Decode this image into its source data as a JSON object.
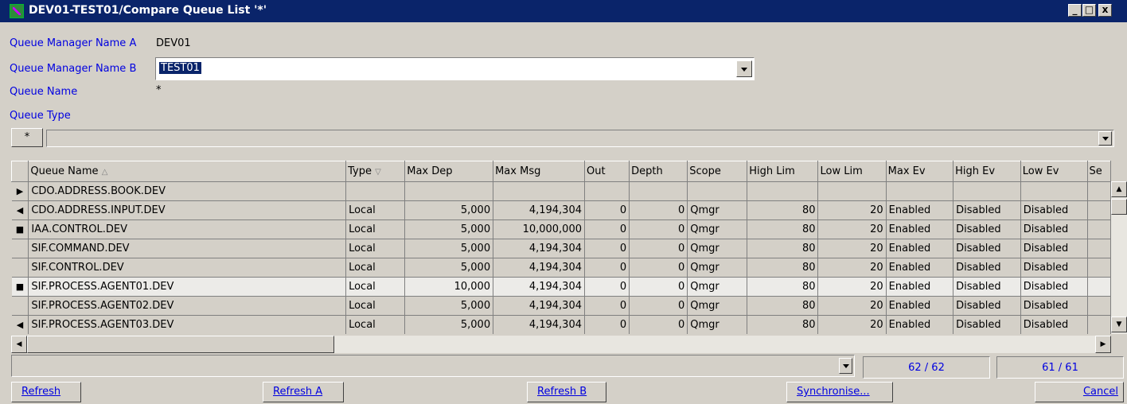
{
  "window": {
    "title": "DEV01-TEST01/Compare Queue List '*'",
    "min": "_",
    "max": "□",
    "close": "x"
  },
  "form": {
    "qm_a_label": "Queue Manager Name A",
    "qm_a_value": "DEV01",
    "qm_b_label": "Queue Manager Name B",
    "qm_b_value": "TEST01",
    "queue_name_label": "Queue Name",
    "queue_name_value": "*",
    "queue_type_label": "Queue Type"
  },
  "filter": {
    "star": "*"
  },
  "columns": [
    "Queue Name",
    "Type",
    "Max Dep",
    "Max Msg",
    "Out",
    "Depth",
    "Scope",
    "High Lim",
    "Low Lim",
    "Max Ev",
    "High Ev",
    "Low Ev",
    "Se"
  ],
  "rows": [
    {
      "ind": "▶",
      "name": "CDO.ADDRESS.BOOK.DEV",
      "type": "",
      "maxdep": "",
      "maxmsg": "",
      "out": "",
      "depth": "",
      "scope": "",
      "high": "",
      "low": "",
      "maxev": "",
      "highev": "",
      "lowev": ""
    },
    {
      "ind": "◀",
      "name": "CDO.ADDRESS.INPUT.DEV",
      "type": "Local",
      "maxdep": "5,000",
      "maxmsg": "4,194,304",
      "out": "0",
      "depth": "0",
      "scope": "Qmgr",
      "high": "80",
      "low": "20",
      "maxev": "Enabled",
      "highev": "Disabled",
      "lowev": "Disabled"
    },
    {
      "ind": "■",
      "name": "IAA.CONTROL.DEV",
      "type": "Local",
      "maxdep": "5,000",
      "maxmsg": "10,000,000",
      "out": "0",
      "depth": "0",
      "scope": "Qmgr",
      "high": "80",
      "low": "20",
      "maxev": "Enabled",
      "highev": "Disabled",
      "lowev": "Disabled"
    },
    {
      "ind": "",
      "name": "SIF.COMMAND.DEV",
      "type": "Local",
      "maxdep": "5,000",
      "maxmsg": "4,194,304",
      "out": "0",
      "depth": "0",
      "scope": "Qmgr",
      "high": "80",
      "low": "20",
      "maxev": "Enabled",
      "highev": "Disabled",
      "lowev": "Disabled"
    },
    {
      "ind": "",
      "name": "SIF.CONTROL.DEV",
      "type": "Local",
      "maxdep": "5,000",
      "maxmsg": "4,194,304",
      "out": "0",
      "depth": "0",
      "scope": "Qmgr",
      "high": "80",
      "low": "20",
      "maxev": "Enabled",
      "highev": "Disabled",
      "lowev": "Disabled"
    },
    {
      "ind": "■",
      "name": "SIF.PROCESS.AGENT01.DEV",
      "type": "Local",
      "maxdep": "10,000",
      "maxmsg": "4,194,304",
      "out": "0",
      "depth": "0",
      "scope": "Qmgr",
      "high": "80",
      "low": "20",
      "maxev": "Enabled",
      "highev": "Disabled",
      "lowev": "Disabled"
    },
    {
      "ind": "",
      "name": "SIF.PROCESS.AGENT02.DEV",
      "type": "Local",
      "maxdep": "5,000",
      "maxmsg": "4,194,304",
      "out": "0",
      "depth": "0",
      "scope": "Qmgr",
      "high": "80",
      "low": "20",
      "maxev": "Enabled",
      "highev": "Disabled",
      "lowev": "Disabled"
    },
    {
      "ind": "◀",
      "name": "SIF.PROCESS.AGENT03.DEV",
      "type": "Local",
      "maxdep": "5,000",
      "maxmsg": "4,194,304",
      "out": "0",
      "depth": "0",
      "scope": "Qmgr",
      "high": "80",
      "low": "20",
      "maxev": "Enabled",
      "highev": "Disabled",
      "lowev": "Disabled"
    }
  ],
  "counts": {
    "a": "62 / 62",
    "b": "61 / 61"
  },
  "buttons": {
    "refresh": "Refresh",
    "refresh_a": "Refresh A",
    "refresh_b": "Refresh B",
    "synchronise": "Synchronise...",
    "cancel": "Cancel"
  }
}
